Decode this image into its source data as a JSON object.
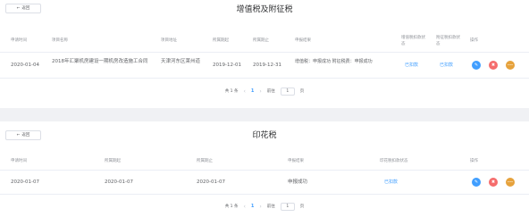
{
  "panel1": {
    "back_label": "返回",
    "title": "增值税及附征税",
    "columns": [
      "申请时间",
      "项目名称",
      "项目地址",
      "所属期起",
      "所属期止",
      "申报结果",
      "增值税扣款状态",
      "附征税扣款状态",
      "操作"
    ],
    "row": {
      "time": "2020-01-04",
      "name": "2018年汇聚机房建设一期机房改造施工合同",
      "address": "天津河东区莱州道",
      "start": "2019-12-01",
      "end": "2019-12-31",
      "result": "增值税：申报成功 附征税费：申报成功",
      "vat_status": "已扣款",
      "surtax_status": "已扣款"
    },
    "pager": {
      "total": "共 1 条",
      "page": "1",
      "goto": "前往",
      "page_input": "1",
      "page_unit": "页"
    }
  },
  "panel2": {
    "back_label": "返回",
    "title": "印花税",
    "columns": [
      "申请时间",
      "所属期起",
      "所属期止",
      "申报结果",
      "印花税扣款状态",
      "操作"
    ],
    "row": {
      "time": "2020-01-07",
      "start": "2020-01-07",
      "end": "2020-01-07",
      "result": "申报成功",
      "stamp_status": "已扣款"
    },
    "pager": {
      "total": "共 1 条",
      "page": "1",
      "goto": "前往",
      "page_input": "1",
      "page_unit": "页"
    }
  },
  "icons": {
    "back": "←",
    "edit": "✎",
    "delete": "✖",
    "more": "•••",
    "prev": "‹",
    "next": "›"
  },
  "colors": {
    "primary": "#409eff",
    "danger": "#f56c6c",
    "warning": "#e6a23c"
  }
}
